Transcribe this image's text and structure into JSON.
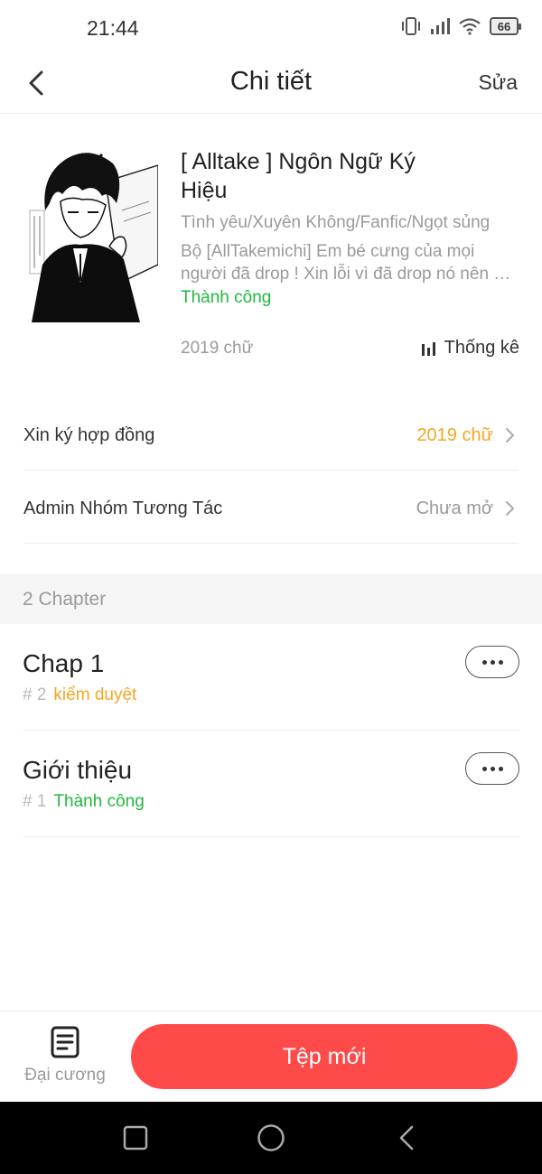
{
  "status_bar": {
    "time": "21:44",
    "battery": "66",
    "icons": [
      "vibrate-icon",
      "signal-icon",
      "wifi-icon",
      "battery-icon"
    ]
  },
  "header": {
    "title": "Chi tiết",
    "edit_label": "Sửa",
    "back_icon": "chevron-left-icon"
  },
  "book": {
    "title": "[ Alltake ] Ngôn Ngữ Ký Hiệu",
    "genres": "Tình yêu/Xuyên Không/Fanfic/Ngọt sủng",
    "description_line1": "Bộ [AllTakemichi] Em bé cưng của mọi",
    "description_line2": "người đã drop ! Xin lỗi vì đã drop nó nên …",
    "status": "Thành công",
    "word_count": "2019 chữ",
    "stats_label": "Thống kê"
  },
  "settings": [
    {
      "label": "Xin ký hợp đồng",
      "value": "2019 chữ",
      "value_color": "#f5a623"
    },
    {
      "label": "Admin Nhóm Tương Tác",
      "value": "Chưa mở",
      "value_color": "#9a9a9a"
    }
  ],
  "chapters_header": "2 Chapter",
  "chapters": [
    {
      "title": "Chap 1",
      "number": "# 2",
      "status": "kiểm duyệt",
      "status_color": "#f5a623"
    },
    {
      "title": "Giới thiệu",
      "number": "# 1",
      "status": "Thành công",
      "status_color": "#21b83d"
    }
  ],
  "bottom": {
    "outline_label": "Đại cương",
    "new_file_label": "Tệp mới"
  },
  "colors": {
    "accent_red": "#ff4a4a",
    "success_green": "#21b83d",
    "warning_orange": "#f5a623"
  }
}
